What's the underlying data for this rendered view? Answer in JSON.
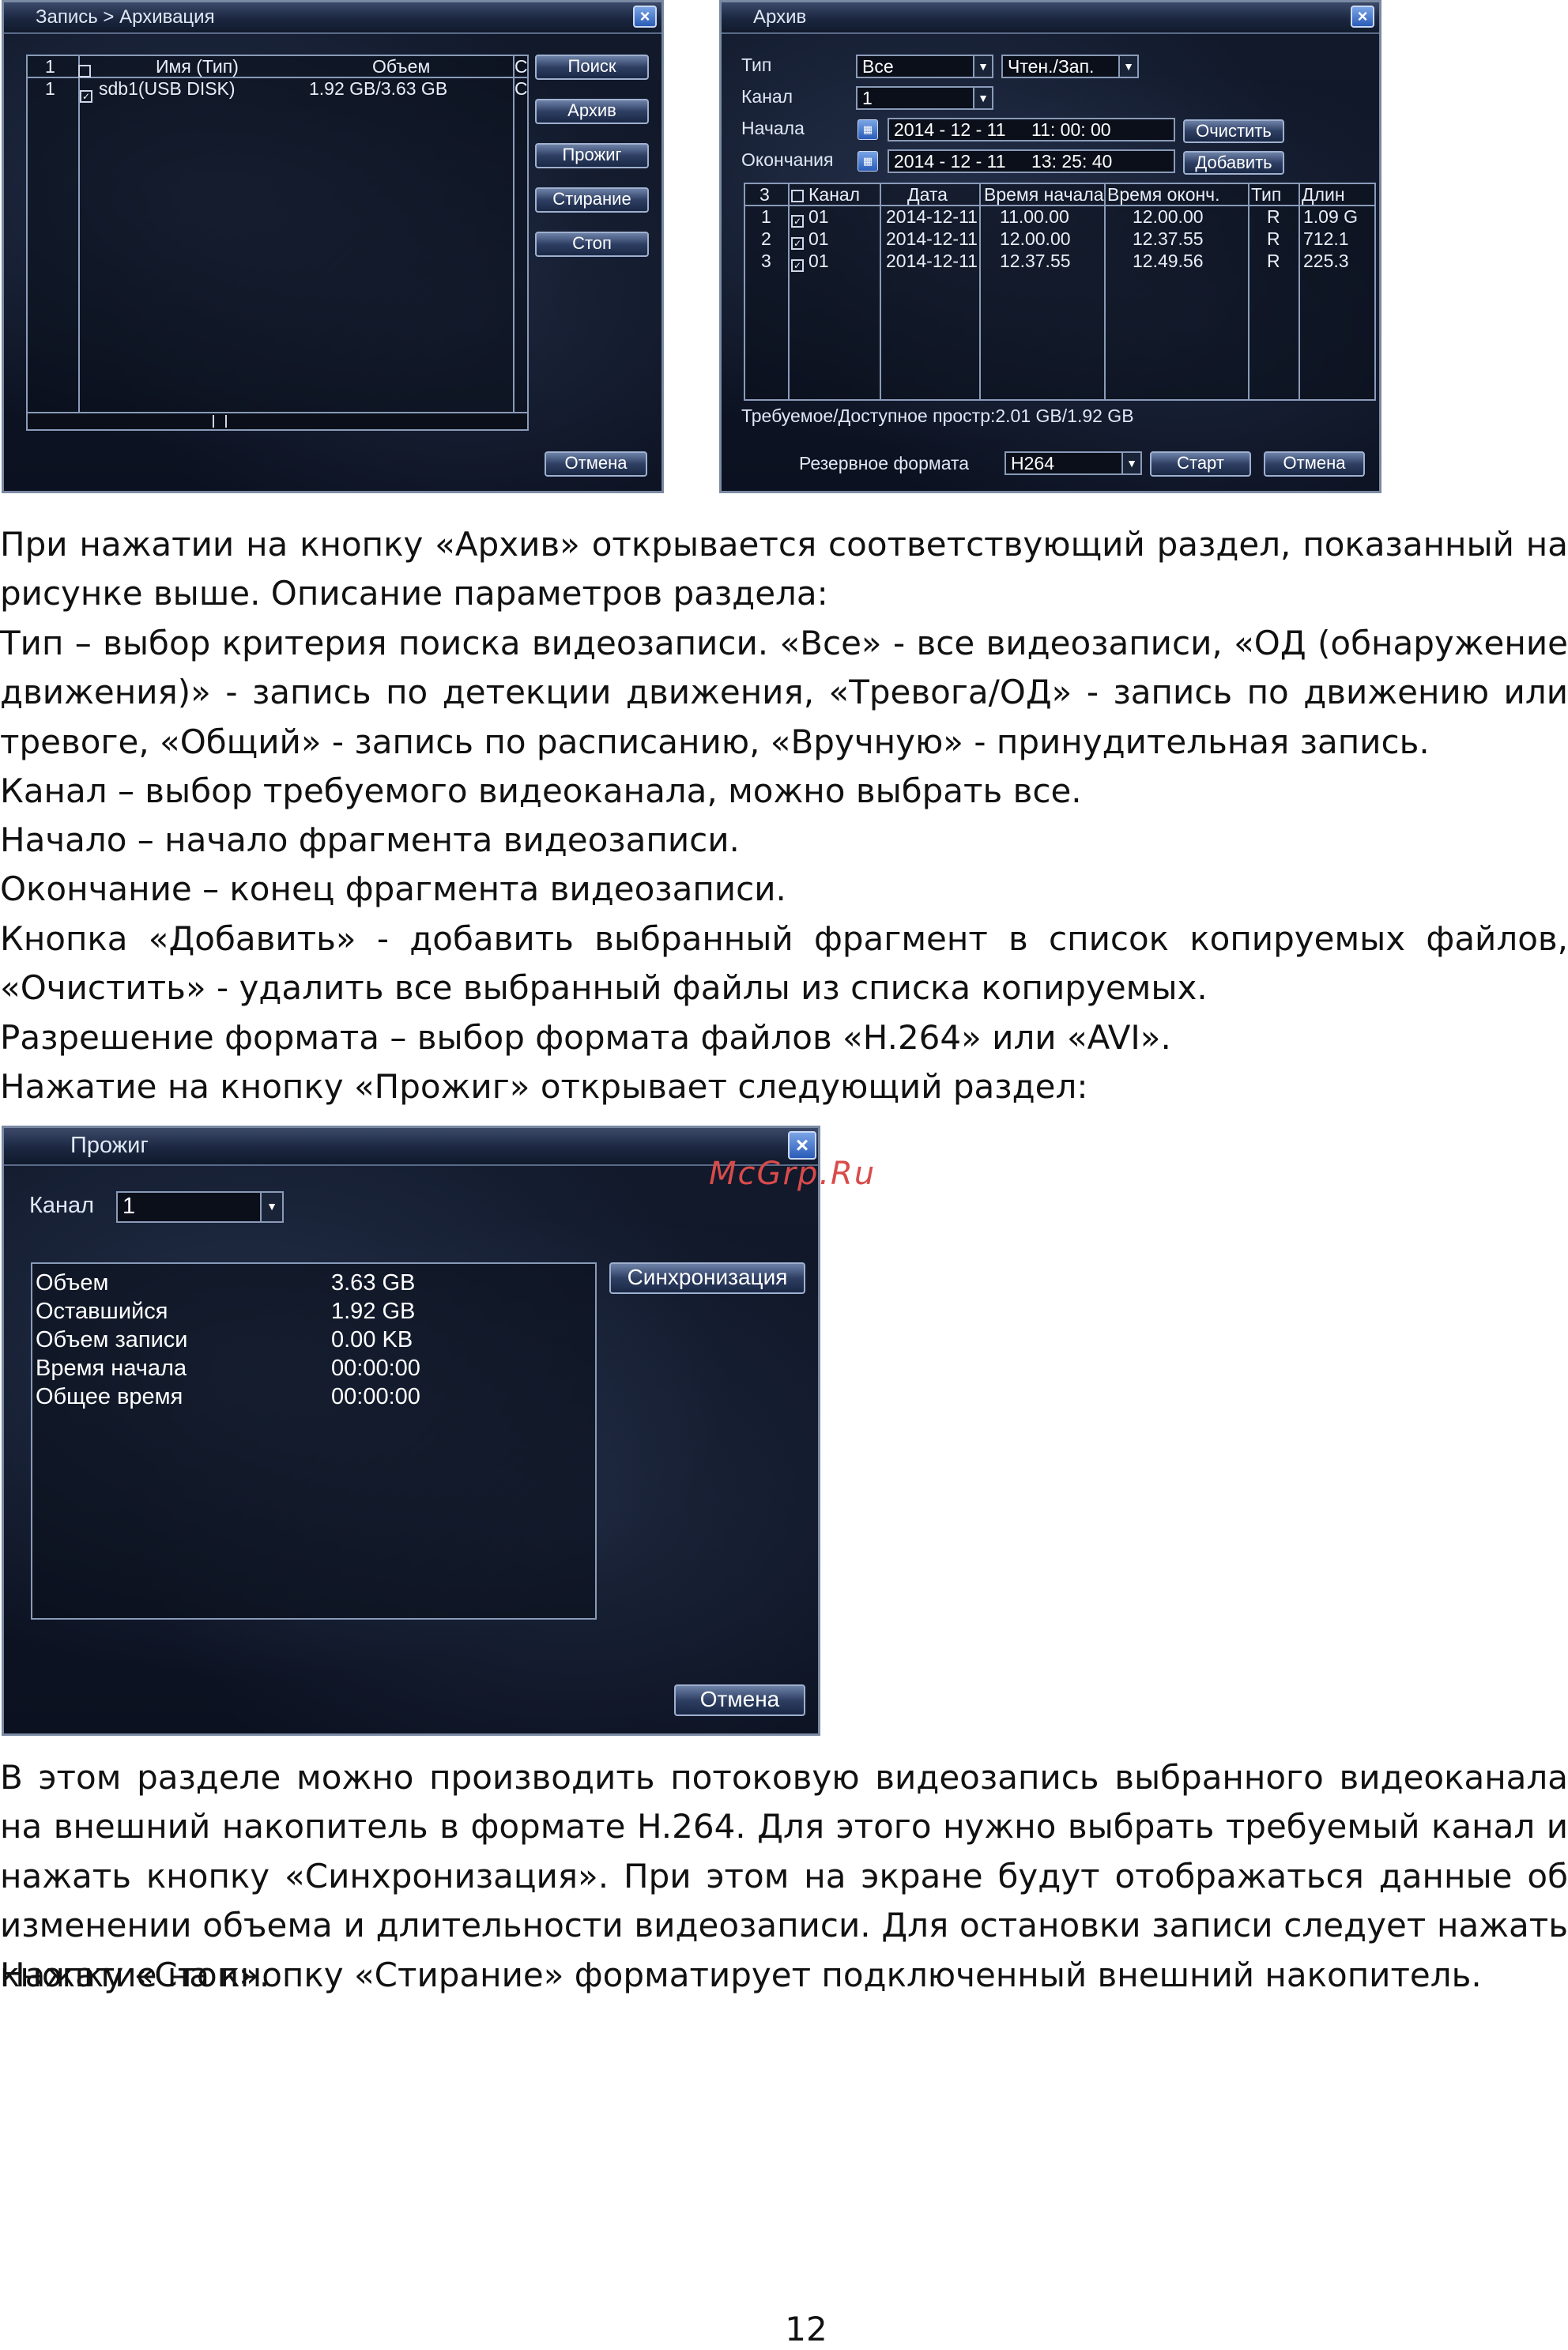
{
  "dialog_backup": {
    "title": "Запись > Архивация",
    "close_glyph": "×",
    "table_headers": [
      "1",
      "",
      "Имя (Тип)",
      "Объем",
      "С"
    ],
    "rows": [
      {
        "num": "1",
        "checked": true,
        "name": "sdb1(USB DISK)",
        "size": "1.92 GB/3.63 GB",
        "extra": "С"
      }
    ],
    "buttons": {
      "search": "Поиск",
      "archive": "Архив",
      "burn": "Прожиг",
      "erase": "Стирание",
      "stop": "Стоп",
      "cancel": "Отмена"
    }
  },
  "dialog_archive": {
    "title": "Архив",
    "close_glyph": "×",
    "type_label": "Тип",
    "type_value": "Все",
    "type2_value": "Чтен./Зап.",
    "channel_label": "Канал",
    "channel_value": "1",
    "start_label": "Начала",
    "start_date": "2014 - 12 - 11",
    "start_time": "11: 00: 00",
    "end_label": "Окончания",
    "end_date": "2014 - 12 - 11",
    "end_time": "13: 25: 40",
    "buttons": {
      "clear": "Очистить",
      "add": "Добавить",
      "start": "Старт",
      "cancel": "Отмена"
    },
    "table_headers": [
      "3",
      "Канал",
      "Дата",
      "Время начала",
      "Время оконч.",
      "Тип",
      "Длин"
    ],
    "rows": [
      {
        "num": "1",
        "channel": "01",
        "date": "2014-12-11",
        "start": "11.00.00",
        "end": "12.00.00",
        "type": "R",
        "len": "1.09 G"
      },
      {
        "num": "2",
        "channel": "01",
        "date": "2014-12-11",
        "start": "12.00.00",
        "end": "12.37.55",
        "type": "R",
        "len": "712.1"
      },
      {
        "num": "3",
        "channel": "01",
        "date": "2014-12-11",
        "start": "12.37.55",
        "end": "12.49.56",
        "type": "R",
        "len": "225.3"
      }
    ],
    "space_text": "Требуемое/Доступное простр:2.01 GB/1.92 GB",
    "format_label": "Резервное формата",
    "format_value": "H264"
  },
  "text_top": {
    "p1": "При нажатии на кнопку «Архив» открывается соответствующий раздел, показанный на рисунке выше. Описание параметров раздела:",
    "p2": "Тип – выбор критерия поиска видеозаписи. «Все» - все видеозаписи, «ОД (обнаружение движения)» - запись по детекции движения, «Тревога/ОД» - запись по движению или тревоге, «Общий» - запись по расписанию, «Вручную» - принудительная запись.",
    "p3": "Канал – выбор требуемого видеоканала, можно выбрать все.",
    "p4": "Начало – начало фрагмента видеозаписи.",
    "p5": "Окончание – конец фрагмента видеозаписи.",
    "p6": "Кнопка «Добавить» - добавить выбранный фрагмент в список копируемых файлов, «Очистить» - удалить все выбранный файлы из списка копируемых.",
    "p7": "Разрешение формата – выбор формата файлов «H.264» или «AVI».",
    "p8": "Нажатие на кнопку «Прожиг» открывает следующий раздел:"
  },
  "dialog_burn": {
    "title": "Прожиг",
    "close_glyph": "×",
    "channel_label": "Канал",
    "channel_value": "1",
    "sync_button": "Синхронизация",
    "cancel_button": "Отмена",
    "info": [
      {
        "label": "Объем",
        "value": "3.63 GB"
      },
      {
        "label": "Оставшийся",
        "value": "1.92 GB"
      },
      {
        "label": "Объем записи",
        "value": "0.00 KB"
      },
      {
        "label": "Время начала",
        "value": "00:00:00"
      },
      {
        "label": "Общее время",
        "value": "00:00:00"
      }
    ]
  },
  "watermark": "McGrp.Ru",
  "text_bottom": {
    "p1": "В этом разделе можно производить потоковую видеозапись выбранного видеоканала на внешний накопитель в формате H.264. Для этого нужно выбрать требуемый канал и нажать кнопку «Синхронизация». При этом на экране будут отображаться данные об изменении объема и длительности видеозаписи. Для остановки записи следует нажать кнопку «Стоп».",
    "p2": "Нажатие на кнопку «Стирание» форматирует подключенный внешний накопитель."
  },
  "page_number": "12"
}
